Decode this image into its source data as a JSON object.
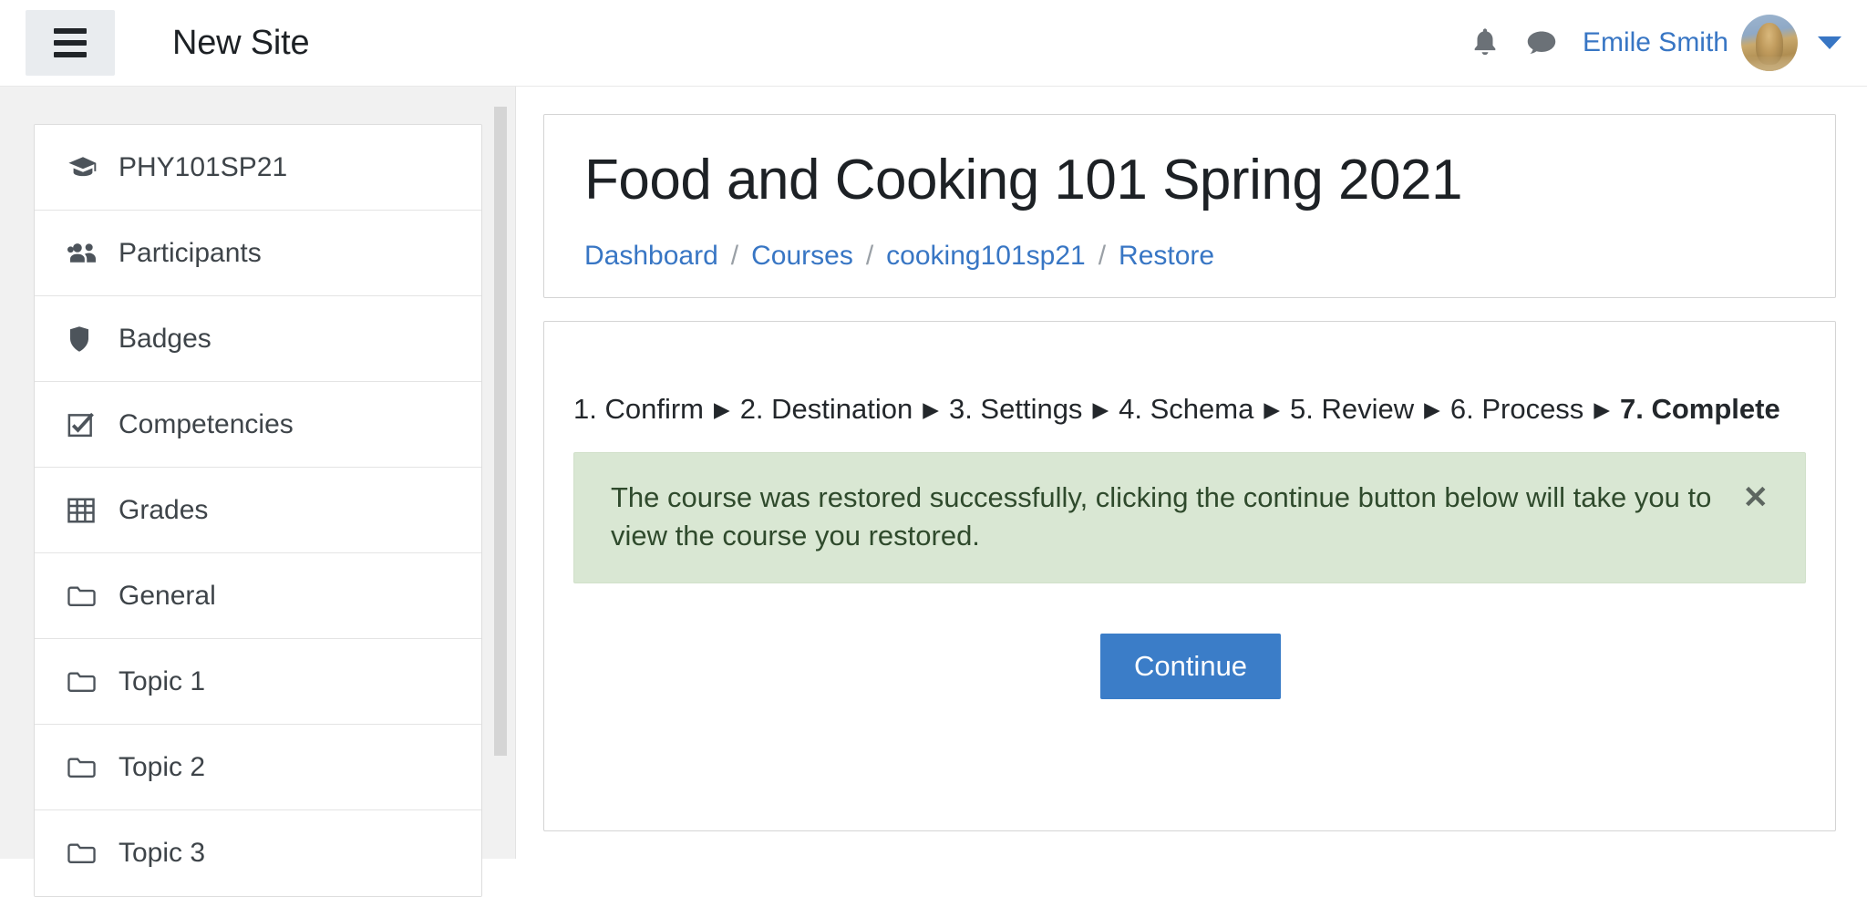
{
  "header": {
    "menu_toggle_label": "hamburger-menu",
    "site_title": "New Site",
    "notifications_icon": "bell-icon",
    "messages_icon": "message-bubble-icon",
    "user_name": "Emile Smith",
    "avatar_alt": "user-avatar",
    "dropdown_icon": "caret-down-icon"
  },
  "sidebar": {
    "items": [
      {
        "label": "PHY101SP21",
        "icon": "graduation-cap-icon"
      },
      {
        "label": "Participants",
        "icon": "users-icon"
      },
      {
        "label": "Badges",
        "icon": "shield-icon"
      },
      {
        "label": "Competencies",
        "icon": "checkbox-checked-icon"
      },
      {
        "label": "Grades",
        "icon": "table-grid-icon"
      },
      {
        "label": "General",
        "icon": "folder-icon"
      },
      {
        "label": "Topic 1",
        "icon": "folder-icon"
      },
      {
        "label": "Topic 2",
        "icon": "folder-icon"
      },
      {
        "label": "Topic 3",
        "icon": "folder-icon"
      }
    ]
  },
  "main": {
    "page_title": "Food and Cooking 101 Spring 2021",
    "breadcrumb": [
      {
        "label": "Dashboard"
      },
      {
        "label": "Courses"
      },
      {
        "label": "cooking101sp21"
      },
      {
        "label": "Restore"
      }
    ],
    "breadcrumb_separator": "/",
    "steps": [
      {
        "label": "1. Confirm",
        "current": false
      },
      {
        "label": "2. Destination",
        "current": false
      },
      {
        "label": "3. Settings",
        "current": false
      },
      {
        "label": "4. Schema",
        "current": false
      },
      {
        "label": "5. Review",
        "current": false
      },
      {
        "label": "6. Process",
        "current": false
      },
      {
        "label": "7. Complete",
        "current": true
      }
    ],
    "step_arrow": "▶",
    "alert": {
      "message": "The course was restored successfully, clicking the continue button below will take you to view the course you restored.",
      "close_label": "✕",
      "background_color": "#d9e7d3"
    },
    "continue_button": {
      "label": "Continue",
      "color": "#3b7dc8"
    }
  }
}
